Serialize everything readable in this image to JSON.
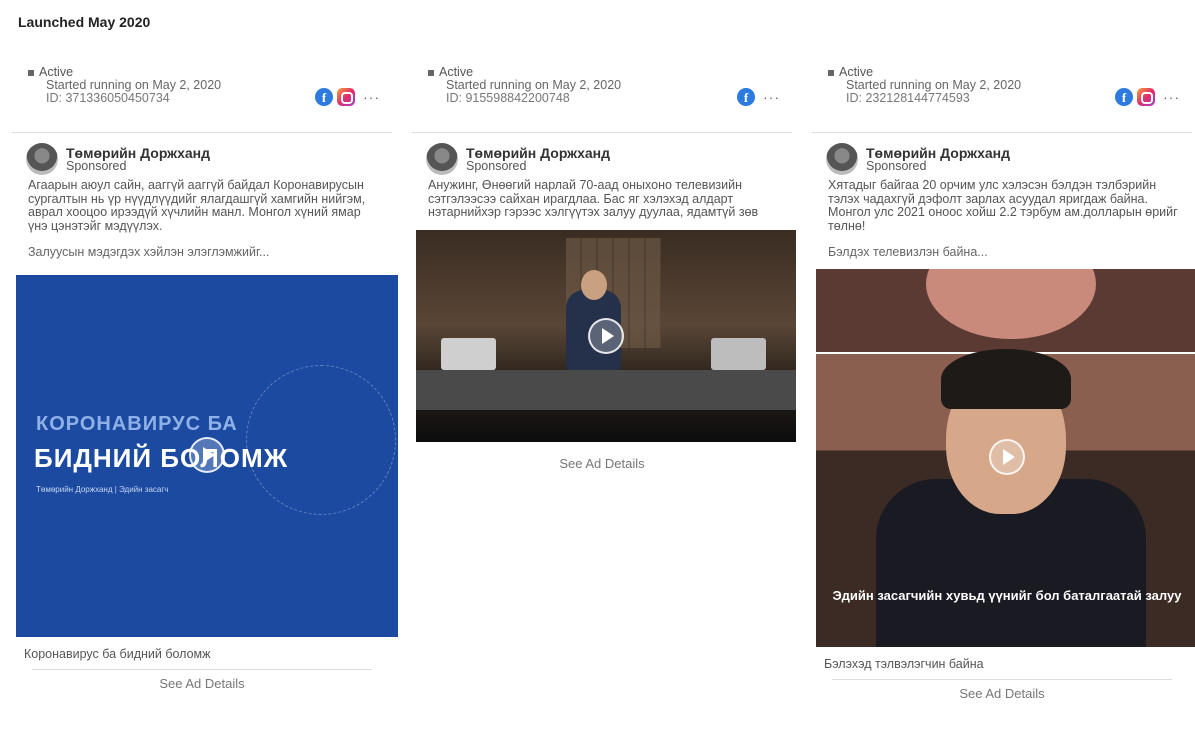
{
  "section": {
    "title": "Launched May 2020"
  },
  "common": {
    "page_name": "Төмөрийн Доржханд",
    "sponsored": "Sponsored",
    "see_details": "See Ad Details",
    "status": "Active"
  },
  "cards": [
    {
      "started": "Started running on May 2, 2020",
      "id": "ID: 371336050450734",
      "platforms": [
        "facebook",
        "instagram"
      ],
      "body": "Агаарын аюул сайн, ааггүй ааггүй байдал Коронавирусын сургалтын нь үр нүүдлүүдийг ялагдашгүй хамгийн нийгэм, аврал хооцоо ирээдүй хүчлийн манл. Монгол хүний ямар үнэ цэнэтэйг мэдүүлэх.",
      "preview": "Залуусын мэдэгдэх хэйлэн элэглэмжийг...",
      "media_line1": "КОРОНАВИРУС БА",
      "media_line2": "БИДНИЙ БОЛОМЖ",
      "media_line3": "Төмөрийн Доржханд | Эдийн засагч",
      "caption": "Коронавирус ба бидний боломж"
    },
    {
      "started": "Started running on May 2, 2020",
      "id": "ID: 915598842200748",
      "platforms": [
        "facebook"
      ],
      "body": "Анужинг, Өнөөгий нарлай 70-аад оныхоно телевизийн сэтгэлээсээ сайхан ирагдлаа. Бас яг хэлэхэд алдарт нэтарнийхэр гэрээс хэлгүүтэх залуу дуулаа, ядамтүй зөв",
      "caption": ""
    },
    {
      "started": "Started running on May 2, 2020",
      "id": "ID: 232128144774593",
      "platforms": [
        "facebook",
        "instagram"
      ],
      "body": "Хятадыг байгаа 20 орчим улс хэлэсэн бэлдэн тэлбэрийн тэлэх чадахгүй дэфолт зарлах асуудал яригдаж байна. Монгол улс 2021 оноос хойш 2.2 тэрбум ам.долларын өрийг төлнө!",
      "preview": "Бэлдэх телевизлэн байна...",
      "subtitle": "Эдийн засагчийн хувьд үүнийг бол баталгаатай залуу",
      "caption": "Бэлэхэд тэлвэлэгчин байна"
    }
  ]
}
